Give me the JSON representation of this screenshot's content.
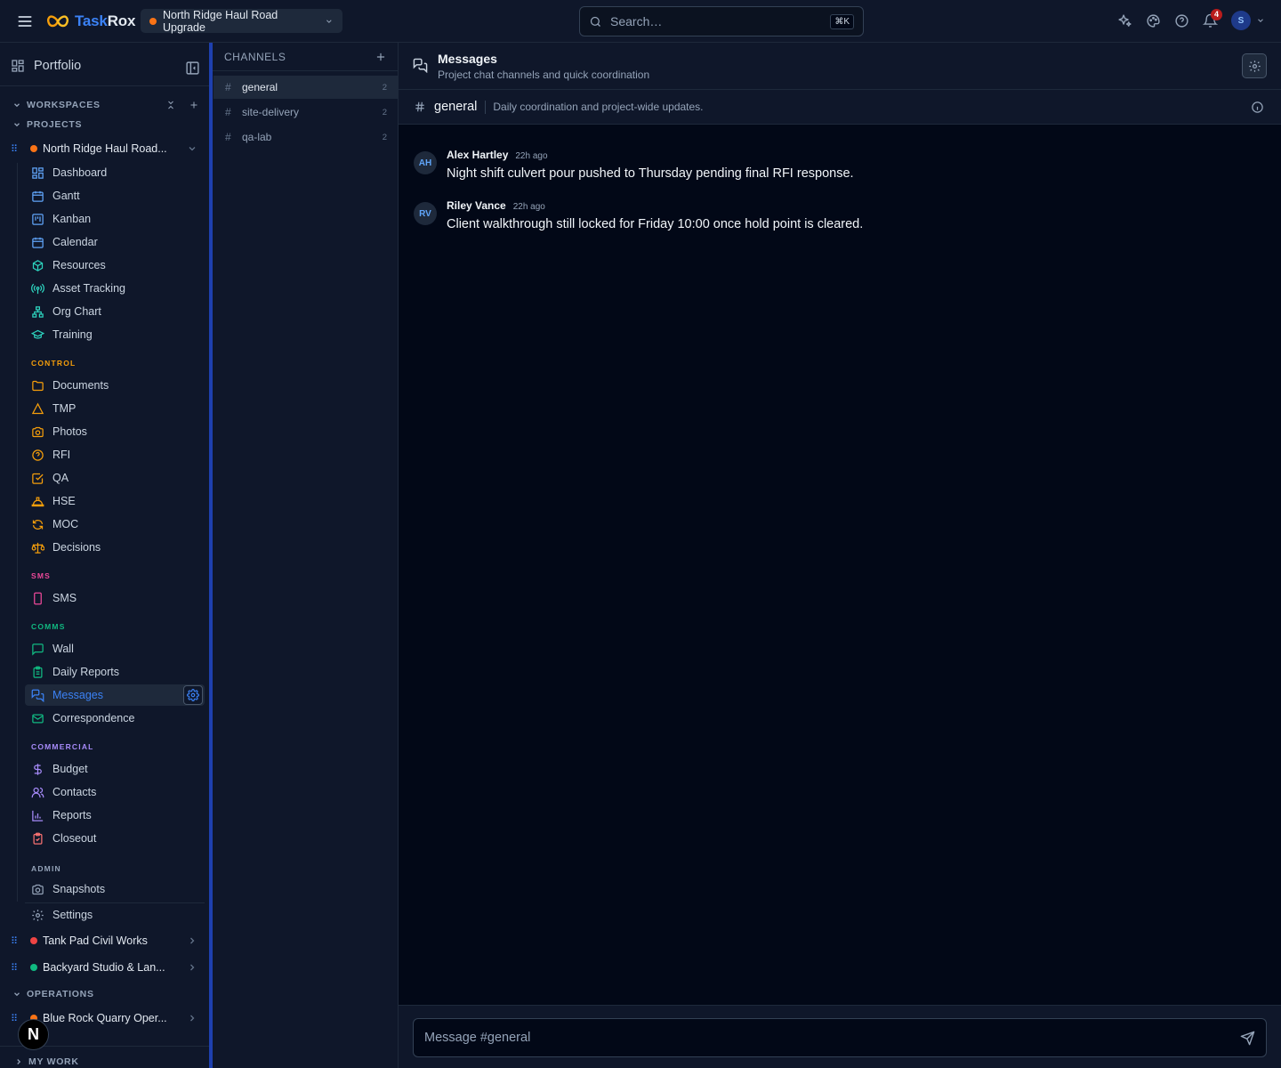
{
  "app": {
    "logo_a": "Task",
    "logo_b": "Rox"
  },
  "topbar": {
    "project_name": "North Ridge Haul Road Upgrade",
    "search_placeholder": "Search…",
    "search_shortcut": "⌘K",
    "notification_count": "4",
    "user_initial": "S"
  },
  "sidebar": {
    "portfolio": "Portfolio",
    "workspaces": "WORKSPACES",
    "projects": "PROJECTS",
    "operations": "OPERATIONS",
    "my_work": "MY WORK",
    "project_list": [
      {
        "name": "North Ridge Haul Road...",
        "color": "#f97316"
      },
      {
        "name": "Tank Pad Civil Works",
        "color": "#ef4444"
      },
      {
        "name": "Backyard Studio & Lan...",
        "color": "#10b981"
      }
    ],
    "operation_list": [
      {
        "name": "Blue Rock Quarry Oper...",
        "color": "#f97316"
      }
    ],
    "nav": [
      {
        "label": "Dashboard",
        "icon": "dashboard-icon",
        "color": "#60a5fa"
      },
      {
        "label": "Gantt",
        "icon": "calendar-icon",
        "color": "#60a5fa"
      },
      {
        "label": "Kanban",
        "icon": "kanban-icon",
        "color": "#60a5fa"
      },
      {
        "label": "Calendar",
        "icon": "calendar-icon",
        "color": "#60a5fa"
      },
      {
        "label": "Resources",
        "icon": "box-icon",
        "color": "#2dd4bf"
      },
      {
        "label": "Asset Tracking",
        "icon": "radio-icon",
        "color": "#2dd4bf"
      },
      {
        "label": "Org Chart",
        "icon": "org-chart-icon",
        "color": "#2dd4bf"
      },
      {
        "label": "Training",
        "icon": "graduation-cap-icon",
        "color": "#2dd4bf"
      }
    ],
    "control_label": "CONTROL",
    "control_color": "#f59e0b",
    "control": [
      {
        "label": "Documents",
        "icon": "folder-icon"
      },
      {
        "label": "TMP",
        "icon": "cone-icon"
      },
      {
        "label": "Photos",
        "icon": "camera-icon"
      },
      {
        "label": "RFI",
        "icon": "help-circle-icon"
      },
      {
        "label": "QA",
        "icon": "check-square-icon"
      },
      {
        "label": "HSE",
        "icon": "hard-hat-icon"
      },
      {
        "label": "MOC",
        "icon": "refresh-icon"
      },
      {
        "label": "Decisions",
        "icon": "scale-icon"
      }
    ],
    "sms_label": "SMS",
    "sms_color": "#ec4899",
    "sms": [
      {
        "label": "SMS",
        "icon": "phone-icon"
      }
    ],
    "comms_label": "COMMS",
    "comms_color": "#10b981",
    "comms": [
      {
        "label": "Wall",
        "icon": "message-square-icon"
      },
      {
        "label": "Daily Reports",
        "icon": "clipboard-icon"
      },
      {
        "label": "Messages",
        "icon": "messages-icon"
      },
      {
        "label": "Correspondence",
        "icon": "mail-icon"
      }
    ],
    "commercial_label": "COMMERCIAL",
    "commercial_color": "#a78bfa",
    "commercial": [
      {
        "label": "Budget",
        "icon": "dollar-icon"
      },
      {
        "label": "Contacts",
        "icon": "users-icon"
      },
      {
        "label": "Reports",
        "icon": "bar-chart-icon"
      },
      {
        "label": "Closeout",
        "icon": "clipboard-check-icon"
      }
    ],
    "admin_label": "ADMIN",
    "admin_color": "#94a3b8",
    "admin": [
      {
        "label": "Snapshots",
        "icon": "camera-icon"
      },
      {
        "label": "Settings",
        "icon": "gear-icon"
      }
    ]
  },
  "channels": {
    "title": "CHANNELS",
    "items": [
      {
        "name": "general",
        "count": "2"
      },
      {
        "name": "site-delivery",
        "count": "2"
      },
      {
        "name": "qa-lab",
        "count": "2"
      }
    ]
  },
  "main": {
    "title": "Messages",
    "subtitle": "Project chat channels and quick coordination",
    "channel_name": "general",
    "channel_desc": "Daily coordination and project-wide updates.",
    "messages": [
      {
        "initials": "AH",
        "author": "Alex Hartley",
        "time": "22h ago",
        "text": "Night shift culvert pour pushed to Thursday pending final RFI response."
      },
      {
        "initials": "RV",
        "author": "Riley Vance",
        "time": "22h ago",
        "text": "Client walkthrough still locked for Friday 10:00 once hold point is cleared."
      }
    ],
    "composer_placeholder": "Message #general"
  }
}
